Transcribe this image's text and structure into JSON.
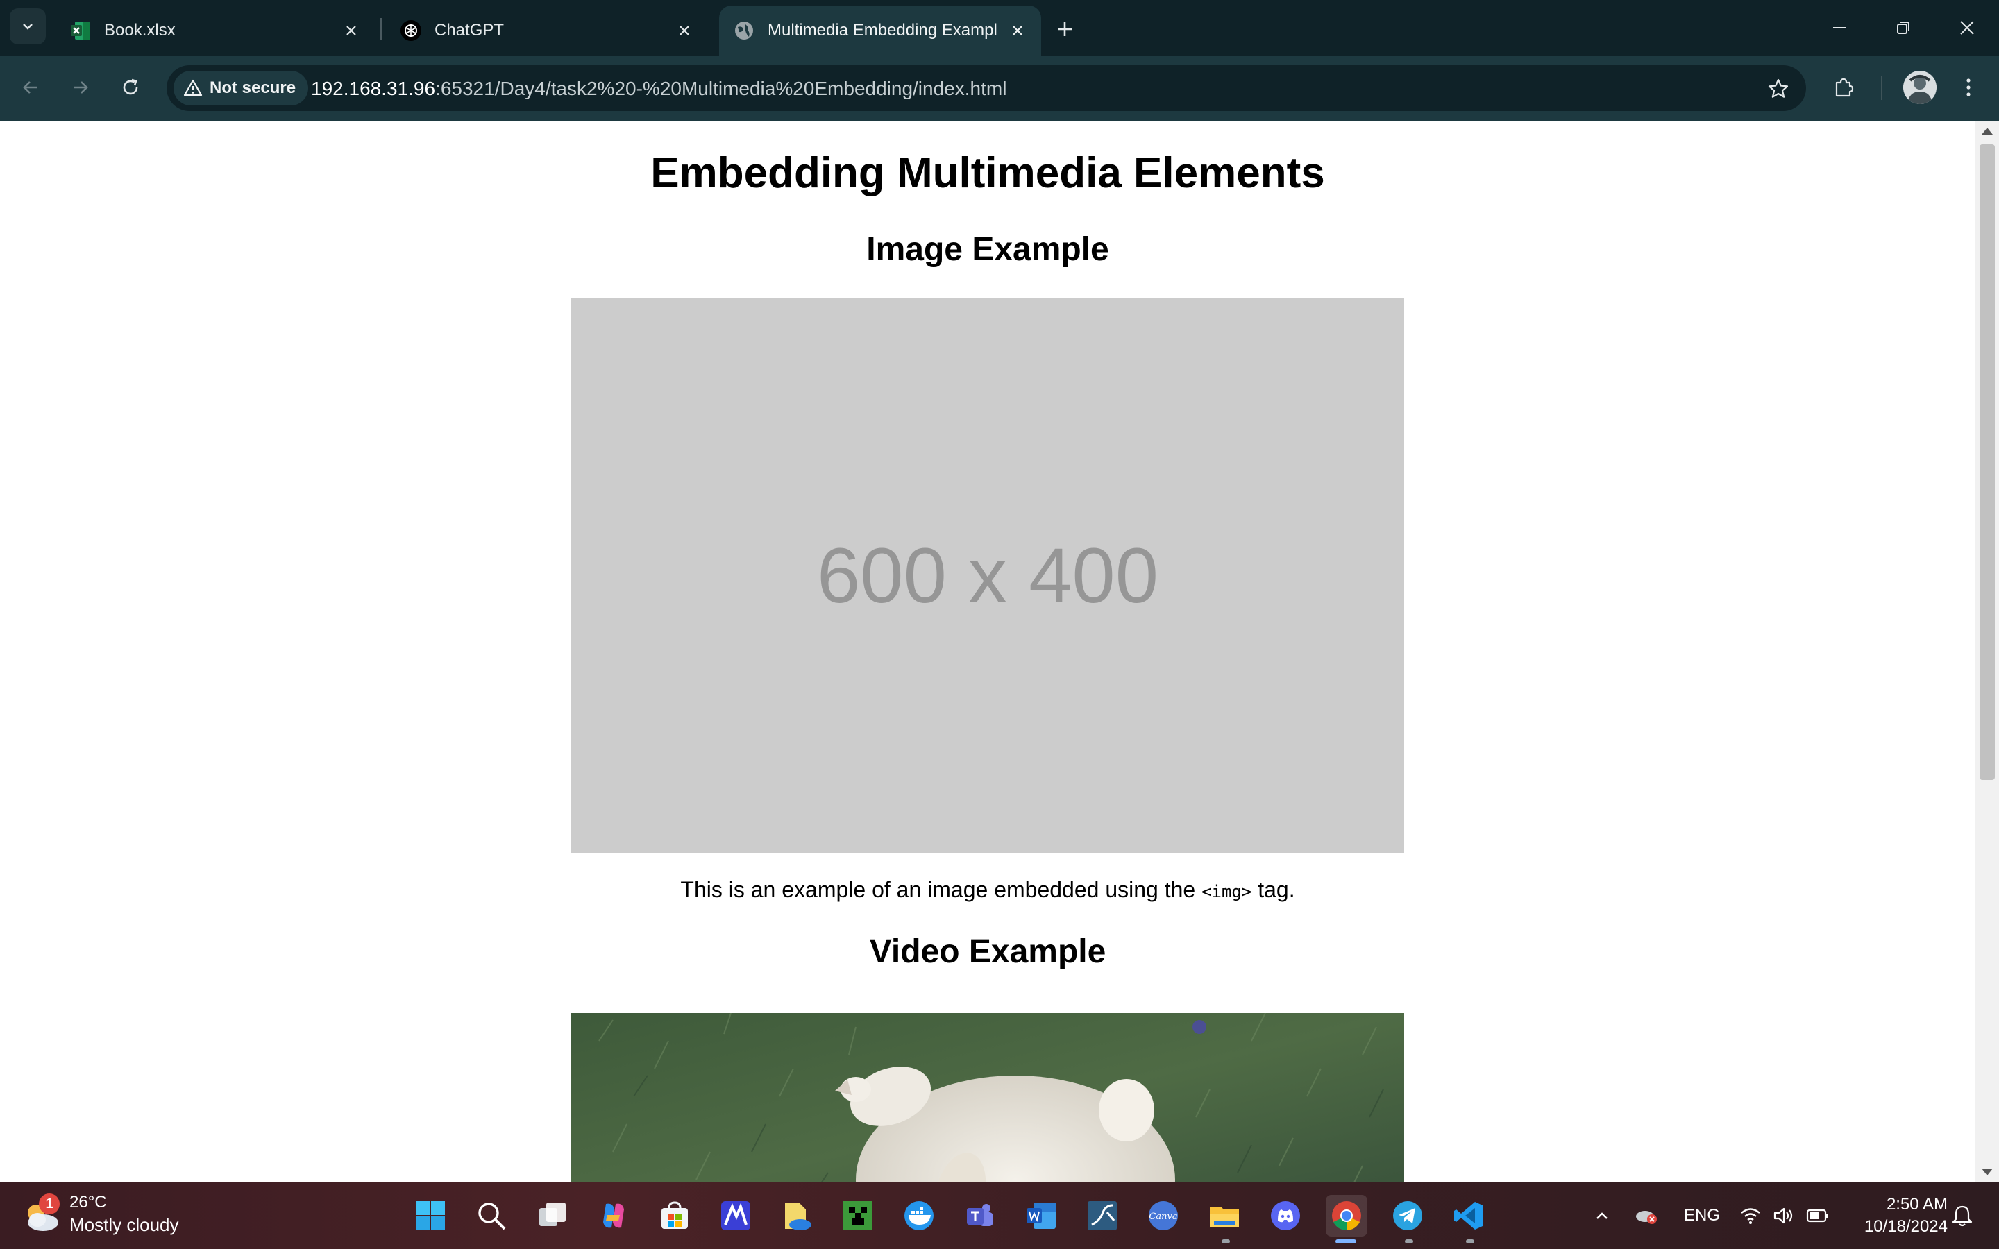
{
  "browser": {
    "tabs": [
      {
        "title": "Book.xlsx",
        "icon": "excel-icon",
        "active": false
      },
      {
        "title": "ChatGPT",
        "icon": "chatgpt-icon",
        "active": false
      },
      {
        "title": "Multimedia Embedding Exampl",
        "icon": "globe-icon",
        "active": true
      }
    ],
    "security_label": "Not secure",
    "url_host": "192.168.31.96",
    "url_path": ":65321/Day4/task2%20-%20Multimedia%20Embedding/index.html"
  },
  "page": {
    "heading": "Embedding Multimedia Elements",
    "image_section_title": "Image Example",
    "placeholder_text": "600 x 400",
    "caption_before": "This is an example of an image embedded using the ",
    "caption_code": "<img>",
    "caption_after": " tag.",
    "video_section_title": "Video Example"
  },
  "taskbar": {
    "weather_badge": "1",
    "temperature": "26°C",
    "condition": "Mostly cloudy",
    "language": "ENG",
    "time": "2:50 AM",
    "date": "10/18/2024"
  },
  "colors": {
    "tab_strip": "#0f2228",
    "toolbar": "#1d3940",
    "placeholder_bg": "#cccccc",
    "placeholder_text": "#969696"
  }
}
